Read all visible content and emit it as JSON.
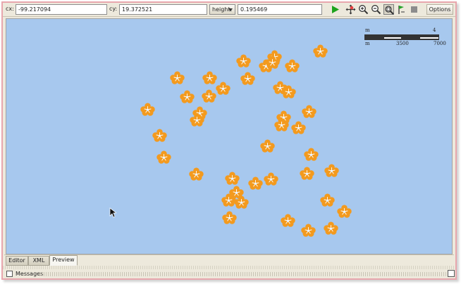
{
  "toolbar": {
    "cx_label": "cx:",
    "cx_value": "-99.217094",
    "cy_label": "cy:",
    "cy_value": "19.372521",
    "height_select": "height:",
    "height_value": "0.195469",
    "buttons": [
      "play-icon",
      "pan-icon",
      "zoom-in-icon",
      "zoom-out-icon",
      "zoom-extent-icon",
      "info-pin-icon",
      "stop-icon"
    ],
    "options_label": "Options"
  },
  "map": {
    "background_color": "#a7c8ee",
    "marker_color": "#f39a1e",
    "marker_icon": "flower-marker-icon",
    "scale_bar": {
      "top_left": "m",
      "top_right": "4",
      "bottom_left": "m",
      "bottom_mid": "3500",
      "bottom_right": "7000"
    }
  },
  "tabs": {
    "editor": "Editor",
    "xml": "XML",
    "preview": "Preview",
    "selected": "Preview"
  },
  "status": {
    "messages_label": "Messages"
  }
}
